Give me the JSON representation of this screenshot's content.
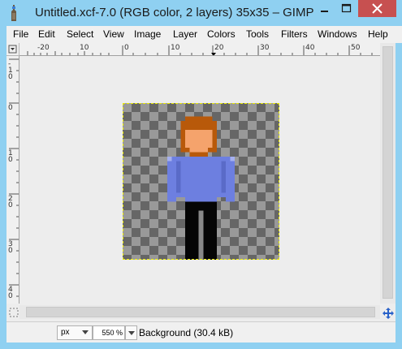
{
  "window": {
    "title": "Untitled.xcf-7.0 (RGB color, 2 layers) 35x35 – GIMP"
  },
  "menu": {
    "items": [
      "File",
      "Edit",
      "Select",
      "View",
      "Image",
      "Layer",
      "Colors",
      "Tools",
      "Filters",
      "Windows",
      "Help"
    ]
  },
  "ruler": {
    "horizontal_labels": [
      "-20",
      "10",
      "0",
      "10",
      "20",
      "30",
      "40",
      "50"
    ],
    "vertical_labels": [
      "-10",
      "0",
      "10",
      "20",
      "30",
      "40"
    ]
  },
  "statusbar": {
    "unit": "px",
    "zoom": "550 %",
    "layer_info": "Background (30.4 kB)"
  },
  "colors": {
    "titlebar": "#8fd0f1",
    "close_button": "#c75050",
    "shirt": "#6d7fe0",
    "hair": "#b8590a",
    "skin": "#f5a36c"
  }
}
